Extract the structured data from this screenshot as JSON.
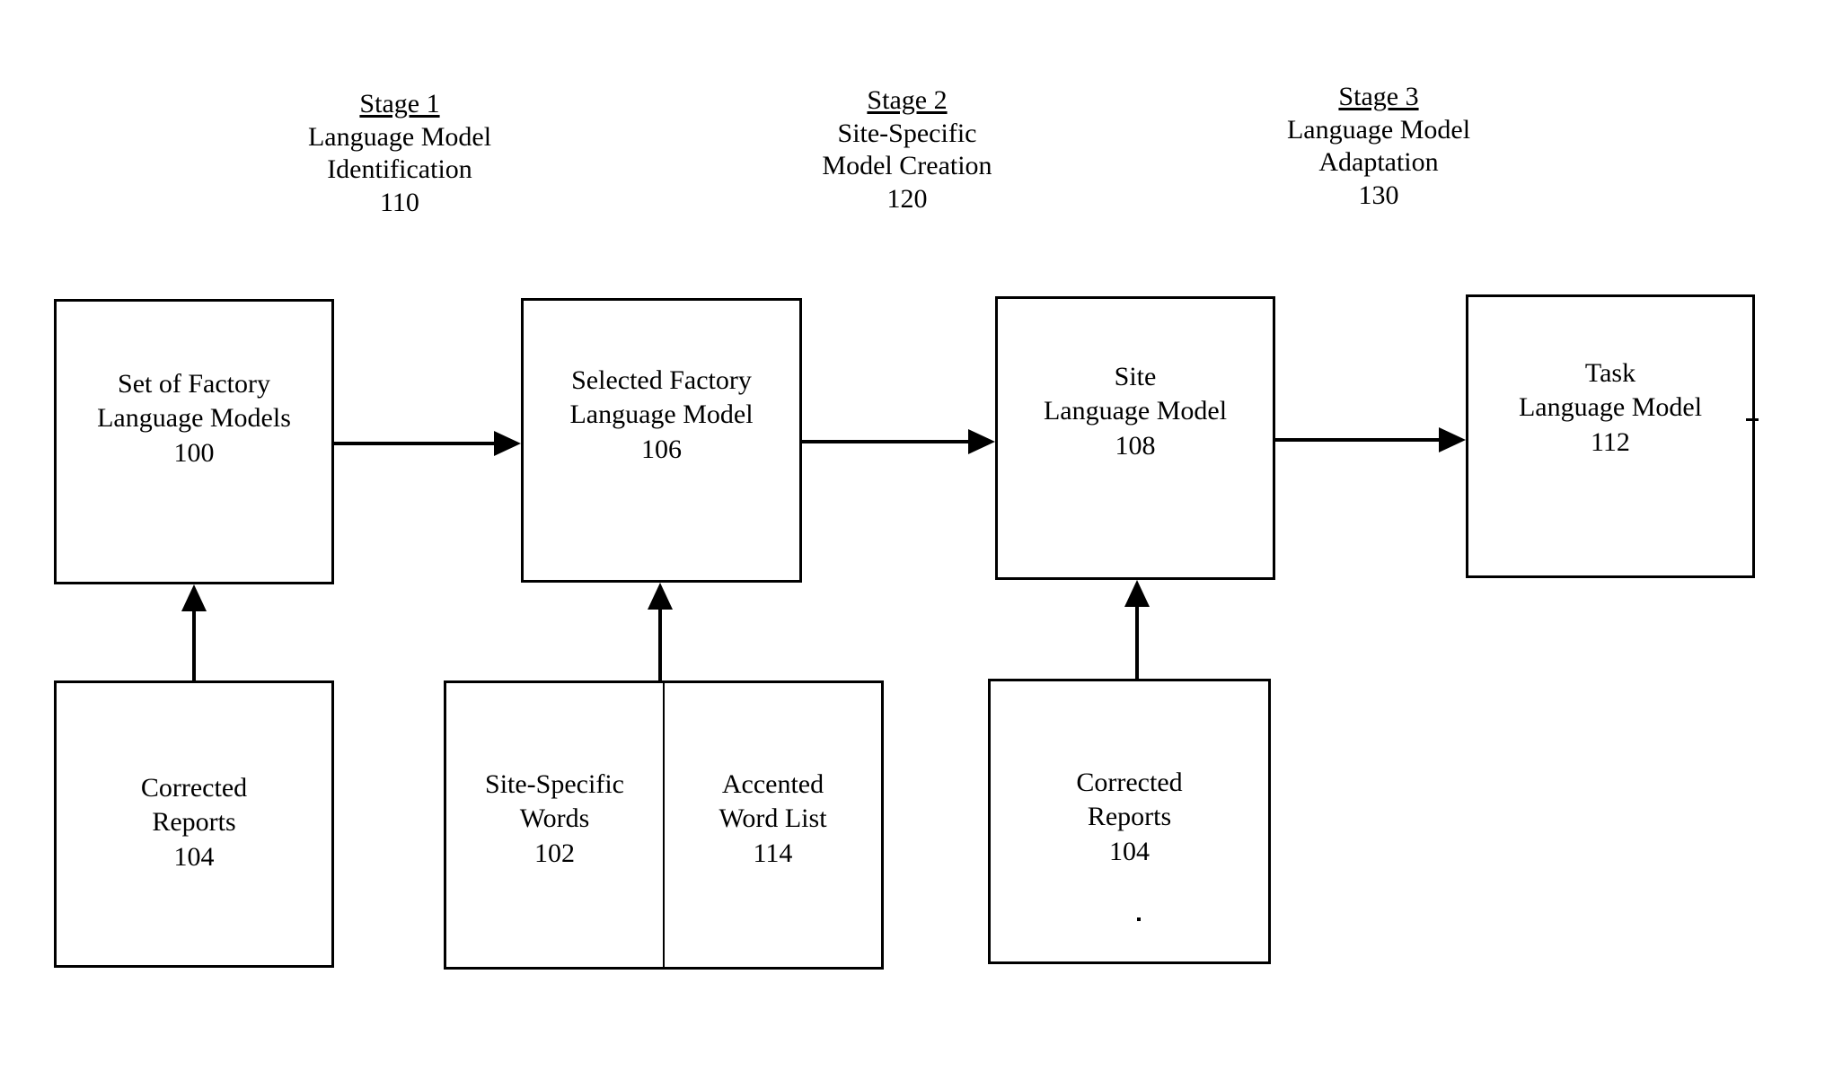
{
  "figure": {
    "type": "patent-flow-diagram",
    "background_color": "#ffffff",
    "line_color": "#000000"
  },
  "stages": [
    {
      "title": "Stage 1",
      "line1": "Language Model",
      "line2": "Identification",
      "number": "110"
    },
    {
      "title": "Stage 2",
      "line1": "Site-Specific",
      "line2": "Model Creation",
      "number": "120"
    },
    {
      "title": "Stage 3",
      "line1": "Language Model",
      "line2": "Adaptation",
      "number": "130"
    }
  ],
  "top_row_boxes": [
    {
      "line1": "Set of Factory",
      "line2": "Language Models",
      "number": "100"
    },
    {
      "line1": "Selected Factory",
      "line2": "Language Model",
      "number": "106"
    },
    {
      "line1": "Site",
      "line2": "Language Model",
      "number": "108"
    },
    {
      "line1": "Task",
      "line2": "Language Model",
      "number": "112"
    }
  ],
  "bottom_row_boxes": [
    {
      "line1": "Corrected",
      "line2": "Reports",
      "number": "104"
    },
    {
      "line1": "Corrected",
      "line2": "Reports",
      "number": "104"
    }
  ],
  "split_box": {
    "left": {
      "line1": "Site-Specific",
      "line2": "Words",
      "number": "102"
    },
    "right": {
      "line1": "Accented",
      "line2": "Word List",
      "number": "114"
    }
  },
  "connections": [
    {
      "from": "Set of Factory Language Models 100",
      "to": "Selected Factory Language Model 106",
      "direction": "right"
    },
    {
      "from": "Selected Factory Language Model 106",
      "to": "Site Language Model 108",
      "direction": "right"
    },
    {
      "from": "Site Language Model 108",
      "to": "Task Language Model 112",
      "direction": "right"
    },
    {
      "from": "Corrected Reports 104",
      "to": "Set of Factory Language Models 100",
      "direction": "up"
    },
    {
      "from": "Site-Specific Words 102 / Accented Word List 114",
      "to": "Selected Factory Language Model 106",
      "direction": "up"
    },
    {
      "from": "Corrected Reports 104",
      "to": "Site Language Model 108",
      "direction": "up"
    }
  ]
}
